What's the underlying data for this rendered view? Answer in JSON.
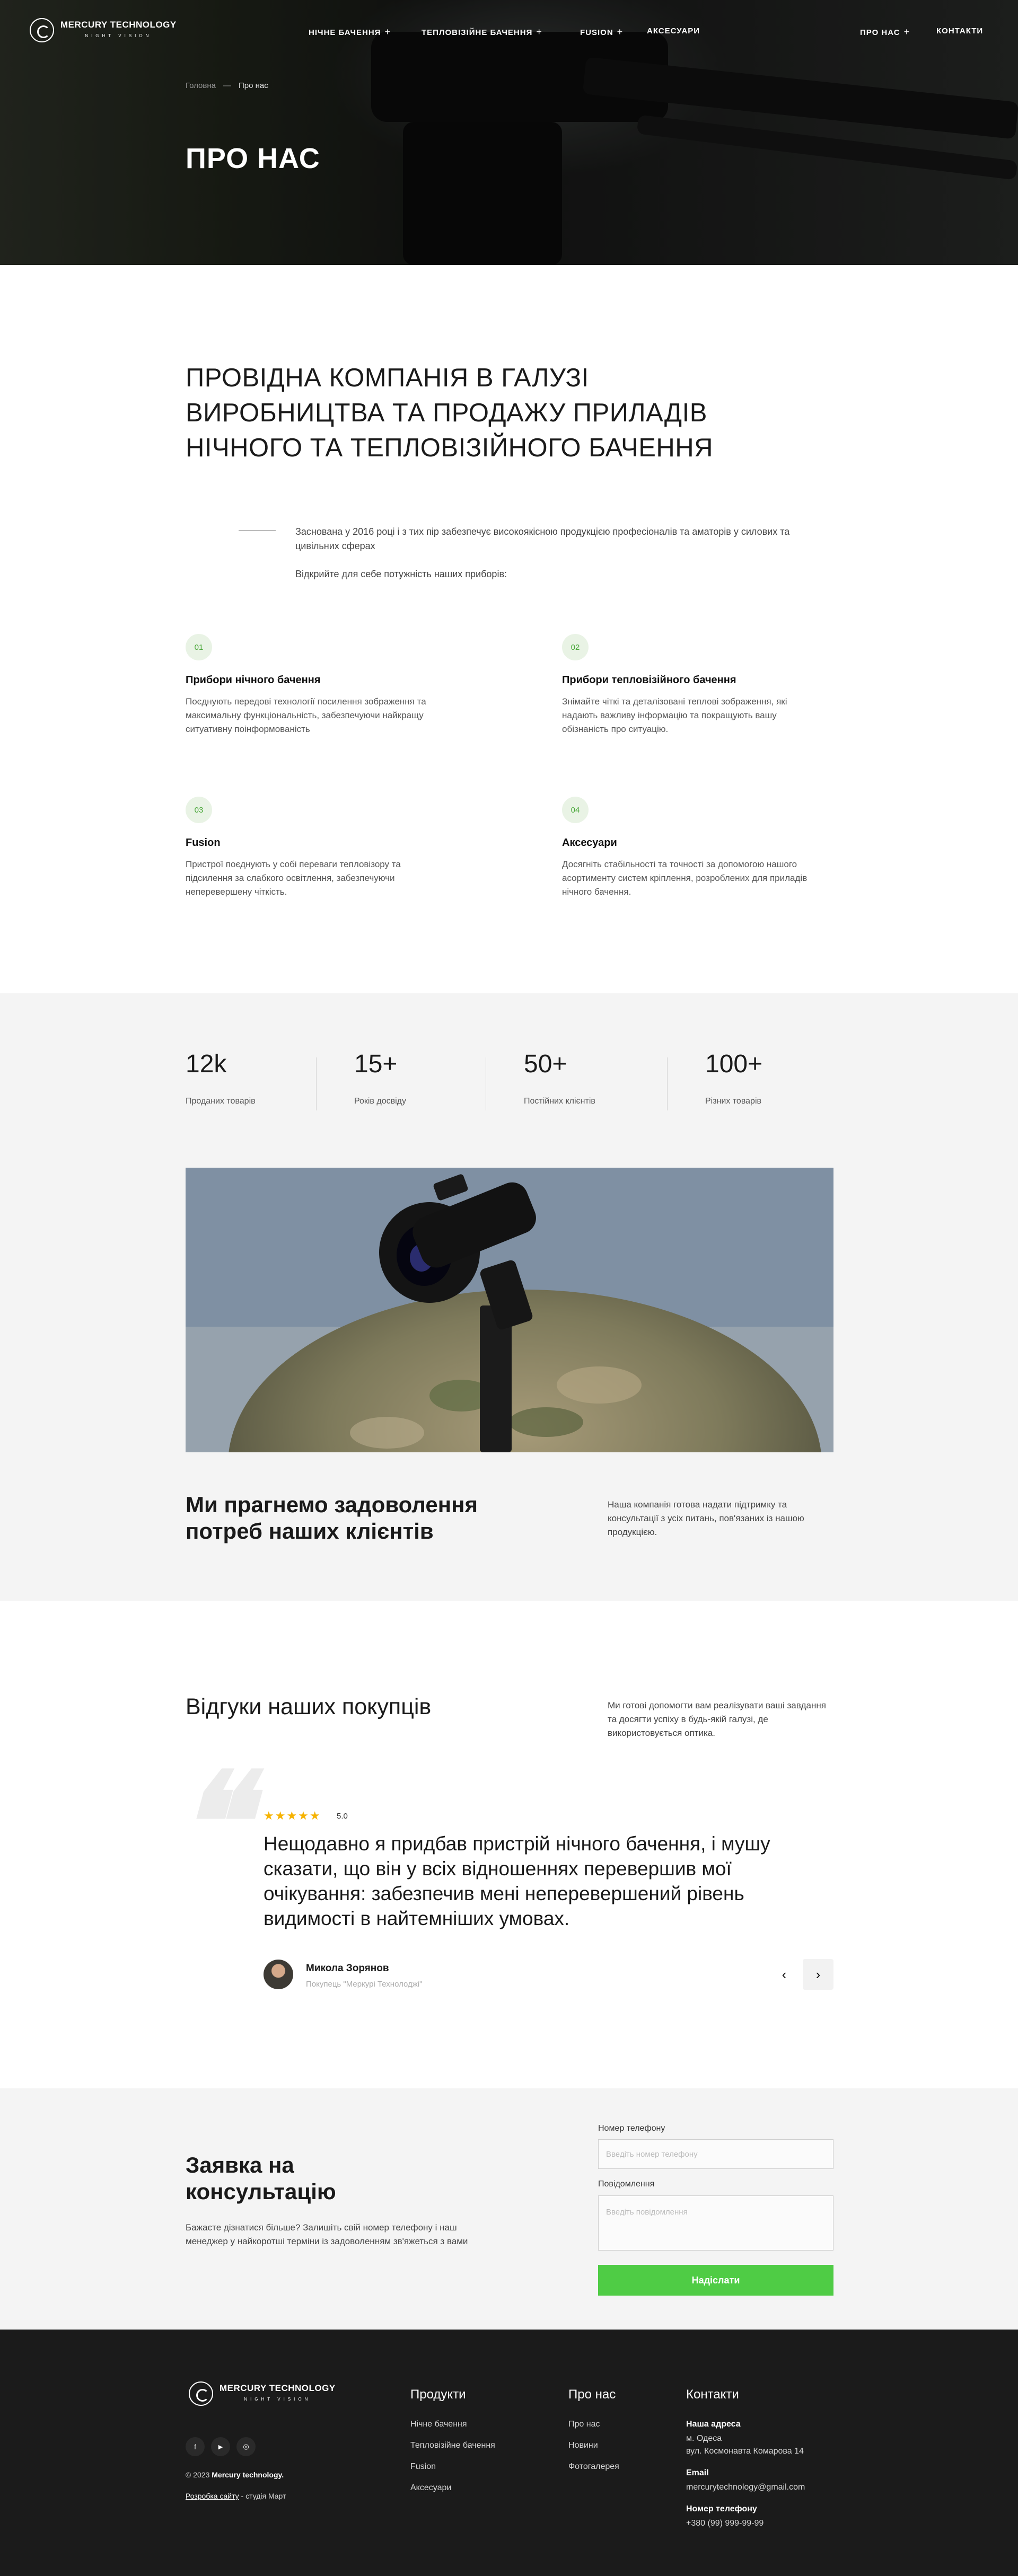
{
  "brand": {
    "name": "MERCURY TECHNOLOGY",
    "tagline": "NIGHT VISION"
  },
  "nav": {
    "items": [
      {
        "label": "НІЧНЕ БАЧЕННЯ",
        "has_submenu": true
      },
      {
        "label": "ТЕПЛОВІЗІЙНЕ БАЧЕННЯ",
        "has_submenu": true
      },
      {
        "label": "FUSION",
        "has_submenu": true
      },
      {
        "label": "АКСЕСУАРИ",
        "has_submenu": false
      }
    ],
    "right": [
      {
        "label": "ПРО НАС",
        "has_submenu": true
      },
      {
        "label": "КОНТАКТИ",
        "has_submenu": false
      }
    ],
    "plus": "+"
  },
  "breadcrumb": {
    "home": "Головна",
    "separator": "—",
    "current": "Про нас"
  },
  "hero": {
    "title": "ПРО НАС"
  },
  "intro": {
    "heading": "ПРОВІДНА КОМПАНІЯ В ГАЛУЗІ ВИРОБНИЦТВА ТА ПРОДАЖУ ПРИЛАДІВ НІЧНОГО ТА ТЕПЛОВІЗІЙНОГО БАЧЕННЯ",
    "text1": "Заснована у 2016 році і з тих пір забезпечує високоякісною продукцією професіоналів та аматорів у силових та цивільних сферах",
    "text2": "Відкрийте для себе потужність наших приборів:"
  },
  "features": [
    {
      "num": "01",
      "title": "Прибори нічного бачення",
      "text": "Поєднують передові технології посилення зображення та максимальну функціональність, забезпечуючи найкращу ситуативну поінформованість"
    },
    {
      "num": "02",
      "title": "Прибори тепловізійного бачення",
      "text": "Знімайте чіткі та деталізовані теплові зображення, які надають важливу інформацію та покращують вашу обізнаність про ситуацію."
    },
    {
      "num": "03",
      "title": "Fusion",
      "text": "Пристрої поєднують у собі переваги тепловізору та підсилення за слабкого освітлення, забезпечуючи неперевершену чіткість."
    },
    {
      "num": "04",
      "title": "Аксесуари",
      "text": "Досягніть стабільності та точності за допомогою нашого асортименту систем кріплення, розроблених для приладів нічного бачення."
    }
  ],
  "stats": [
    {
      "value": "12k",
      "label": "Проданих товарів"
    },
    {
      "value": "15+",
      "label": "Років досвіду"
    },
    {
      "value": "50+",
      "label": "Постійних клієнтів"
    },
    {
      "value": "100+",
      "label": "Різних товарів"
    }
  ],
  "mission": {
    "heading": "Ми прагнемо задоволення потреб наших клієнтів",
    "text": "Наша компанія готова надати підтримку та консультації з усіх питань, пов'язаних із нашою продукцією."
  },
  "reviews": {
    "heading": "Відгуки наших покупців",
    "text": "Ми готові допомогти вам реалізувати ваші завдання та досягти успіху в будь-якій галузі, де використовується оптика.",
    "stars": "★★★★★",
    "rating": "5.0",
    "review": "Нещодавно я придбав пристрій нічного бачення, і мушу сказати, що він у всіх відношеннях перевершив мої очікування: забезпечив мені неперевершений рівень видимості в найтемніших умовах.",
    "author": "Микола Зорянов",
    "role": "Покупець \"Меркурі Технолоджі\"",
    "prev": "‹",
    "next": "›"
  },
  "form": {
    "heading": "Заявка на консультацію",
    "text": "Бажаєте дізнатися більше? Залишіть свій номер телефону і наш менеджер у найкоротші терміни із задоволенням зв'яжеться з вами",
    "phone_label": "Номер телефону",
    "phone_placeholder": "Введіть номер телефону",
    "message_label": "Повідомлення",
    "message_placeholder": "Введіть повідомлення",
    "submit": "Надіслати"
  },
  "footer": {
    "copyright_prefix": "© 2023 ",
    "copyright_brand": "Mercury technology.",
    "dev_link": "Розробка сайту",
    "dev_suffix": " - студія Март",
    "col_products": {
      "title": "Продукти",
      "items": [
        "Нічне бачення",
        "Тепловізійне бачення",
        "Fusion",
        "Аксесуари"
      ]
    },
    "col_about": {
      "title": "Про нас",
      "items": [
        "Про нас",
        "Новини",
        "Фотогалерея"
      ]
    },
    "col_contacts": {
      "title": "Контакти",
      "address_label": "Наша адреса",
      "address_city": "м. Одеса",
      "address_street": "вул. Космонавта Комарова 14",
      "email_label": "Email",
      "email": "mercurytechnology@gmail.com",
      "phone_label": "Номер телефону",
      "phone": "+380 (99) 999-99-99"
    },
    "social": [
      "f",
      "▶",
      "◎"
    ]
  },
  "colors": {
    "accent": "#4fcc45",
    "dark": "#1b1b1b",
    "gray_bg": "#f4f4f4",
    "star": "#f6b300"
  }
}
